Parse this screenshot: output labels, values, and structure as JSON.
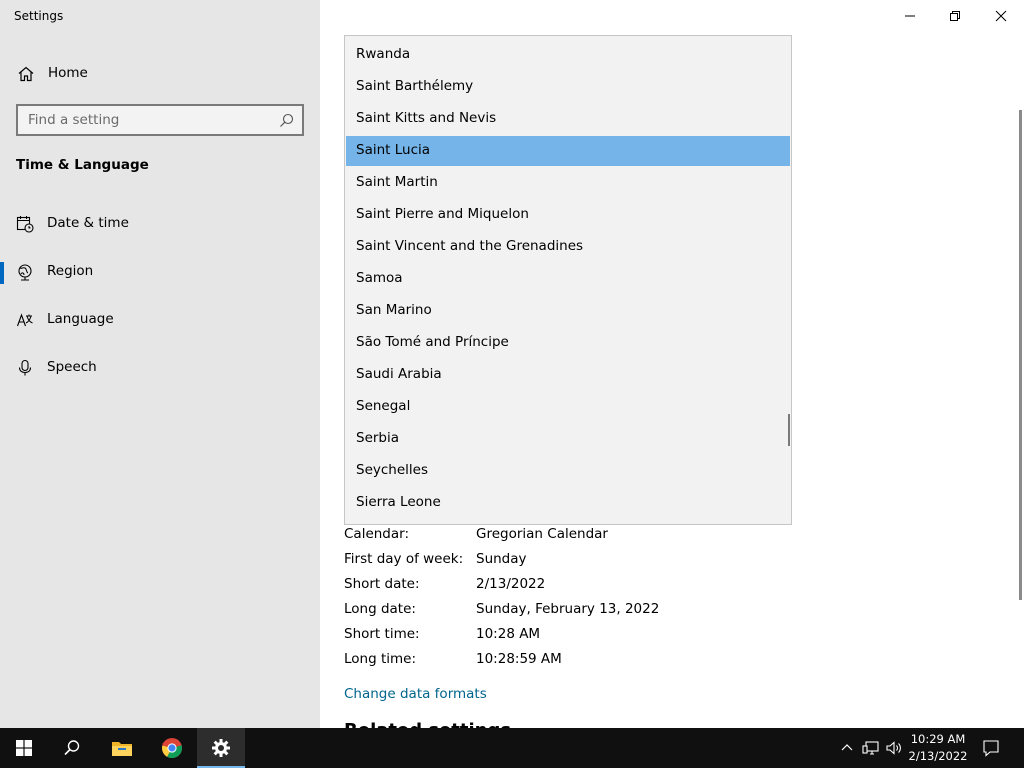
{
  "window": {
    "title": "Settings",
    "controls": {
      "minimize": "minimize",
      "restore": "restore",
      "close": "close"
    }
  },
  "sidebar": {
    "home_label": "Home",
    "search_placeholder": "Find a setting",
    "section_title": "Time & Language",
    "items": [
      {
        "label": "Date & time",
        "icon": "calendar-clock-icon"
      },
      {
        "label": "Region",
        "icon": "globe-icon",
        "active": true
      },
      {
        "label": "Language",
        "icon": "language-icon"
      },
      {
        "label": "Speech",
        "icon": "microphone-icon"
      }
    ]
  },
  "dropdown": {
    "selected": "Saint Lucia",
    "items": [
      "Rwanda",
      "Saint Barthélemy",
      "Saint Kitts and Nevis",
      "Saint Lucia",
      "Saint Martin",
      "Saint Pierre and Miquelon",
      "Saint Vincent and the Grenadines",
      "Samoa",
      "San Marino",
      "São Tomé and Príncipe",
      "Saudi Arabia",
      "Senegal",
      "Serbia",
      "Seychelles",
      "Sierra Leone"
    ]
  },
  "regional_format": {
    "rows": [
      {
        "key": "Calendar:",
        "value": "Gregorian Calendar"
      },
      {
        "key": "First day of week:",
        "value": "Sunday"
      },
      {
        "key": "Short date:",
        "value": "2/13/2022"
      },
      {
        "key": "Long date:",
        "value": "Sunday, February 13, 2022"
      },
      {
        "key": "Short time:",
        "value": "10:28 AM"
      },
      {
        "key": "Long time:",
        "value": "10:28:59 AM"
      }
    ],
    "change_link": "Change data formats",
    "next_heading": "Related settings"
  },
  "taskbar": {
    "apps": [
      "start-icon",
      "search-icon",
      "file-explorer-icon",
      "chrome-icon",
      "settings-icon"
    ],
    "time": "10:29 AM",
    "date": "2/13/2022"
  },
  "colors": {
    "sidebar_bg": "#e6e6e6",
    "accent": "#0067c0",
    "selection": "#74b4e8",
    "link": "#00658d",
    "taskbar": "#101010"
  }
}
